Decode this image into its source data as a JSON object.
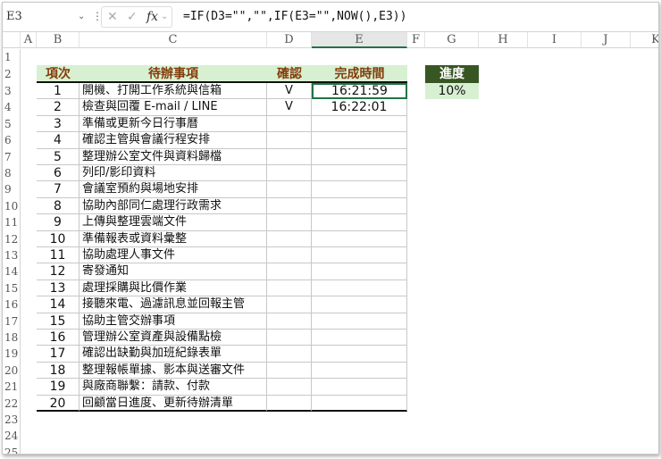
{
  "formula_bar": {
    "name_box": "E3",
    "formula": "=IF(D3=\"\",\"\",IF(E3=\"\",NOW(),E3))",
    "cancel": "✕",
    "enter": "✓",
    "fx": "fx"
  },
  "columns": [
    "A",
    "B",
    "C",
    "D",
    "E",
    "F",
    "G",
    "H",
    "I",
    "J",
    "K"
  ],
  "selected_cell": "E3",
  "headers": {
    "no": "項次",
    "task": "待辦事項",
    "confirm": "確認",
    "time": "完成時間"
  },
  "progress": {
    "label": "進度",
    "value": "10%"
  },
  "colors": {
    "header_bg": "#d8f0d2",
    "header_text": "#833c0b",
    "progress_bg": "#375623",
    "selection": "#217346"
  },
  "tasks": [
    {
      "no": "1",
      "task": "開機、打開工作系統與信箱",
      "confirm": "V",
      "time": "16:21:59"
    },
    {
      "no": "2",
      "task": "檢查與回覆 E-mail / LINE",
      "confirm": "V",
      "time": "16:22:01"
    },
    {
      "no": "3",
      "task": "準備或更新今日行事曆",
      "confirm": "",
      "time": ""
    },
    {
      "no": "4",
      "task": "確認主管與會議行程安排",
      "confirm": "",
      "time": ""
    },
    {
      "no": "5",
      "task": "整理辦公室文件與資料歸檔",
      "confirm": "",
      "time": ""
    },
    {
      "no": "6",
      "task": "列印/影印資料",
      "confirm": "",
      "time": ""
    },
    {
      "no": "7",
      "task": "會議室預約與場地安排",
      "confirm": "",
      "time": ""
    },
    {
      "no": "8",
      "task": "協助內部同仁處理行政需求",
      "confirm": "",
      "time": ""
    },
    {
      "no": "9",
      "task": "上傳與整理雲端文件",
      "confirm": "",
      "time": ""
    },
    {
      "no": "10",
      "task": "準備報表或資料彙整",
      "confirm": "",
      "time": ""
    },
    {
      "no": "11",
      "task": "協助處理人事文件",
      "confirm": "",
      "time": ""
    },
    {
      "no": "12",
      "task": "寄發通知",
      "confirm": "",
      "time": ""
    },
    {
      "no": "13",
      "task": "處理採購與比價作業",
      "confirm": "",
      "time": ""
    },
    {
      "no": "14",
      "task": "接聽來電、過濾訊息並回報主管",
      "confirm": "",
      "time": ""
    },
    {
      "no": "15",
      "task": "協助主管交辦事項",
      "confirm": "",
      "time": ""
    },
    {
      "no": "16",
      "task": "管理辦公室資產與設備點檢",
      "confirm": "",
      "time": ""
    },
    {
      "no": "17",
      "task": "確認出缺勤與加班紀錄表單",
      "confirm": "",
      "time": ""
    },
    {
      "no": "18",
      "task": "整理報帳單據、影本與送審文件",
      "confirm": "",
      "time": ""
    },
    {
      "no": "19",
      "task": "與廠商聯繫：請款、付款",
      "confirm": "",
      "time": ""
    },
    {
      "no": "20",
      "task": "回顧當日進度、更新待辦清單",
      "confirm": "",
      "time": ""
    }
  ]
}
